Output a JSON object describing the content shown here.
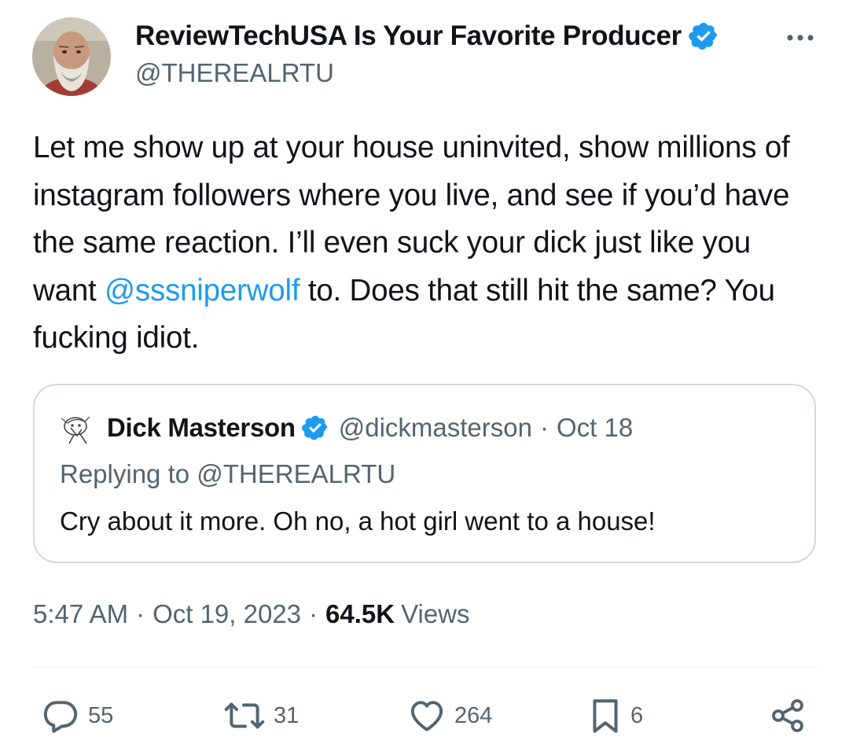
{
  "author": {
    "name": "ReviewTechUSA Is Your Favorite Producer",
    "handle": "@THEREALRTU",
    "verified_color": "#1d9bf0"
  },
  "tweet": {
    "text_part1": "Let me show up at your house uninvited, show millions of instagram followers where you live, and see if you’d have the same reaction. I’ll even suck your dick just like you want ",
    "mention": "@sssniperwolf",
    "text_part2": " to. Does that still hit the same? You fucking idiot."
  },
  "quote": {
    "name": "Dick Masterson",
    "handle": "@dickmasterson",
    "separator": "·",
    "date": "Oct 18",
    "replying_to": "Replying to @THEREALRTU",
    "text": "Cry about it more. Oh no, a hot girl went to a house!"
  },
  "meta": {
    "time": "5:47 AM",
    "separator": "·",
    "date": "Oct 19, 2023",
    "views_count": "64.5K",
    "views_label": "Views"
  },
  "actions": {
    "replies": "55",
    "reposts": "31",
    "likes": "264",
    "bookmarks": "6"
  },
  "icons": {
    "more": "more-dots-icon",
    "reply": "reply-bubble-icon",
    "repost": "repost-arrows-icon",
    "like": "heart-icon",
    "bookmark": "bookmark-icon",
    "share": "share-icon"
  },
  "colors": {
    "accent": "#1d9bf0",
    "secondary_text": "#536471",
    "border": "#cfd9de"
  }
}
